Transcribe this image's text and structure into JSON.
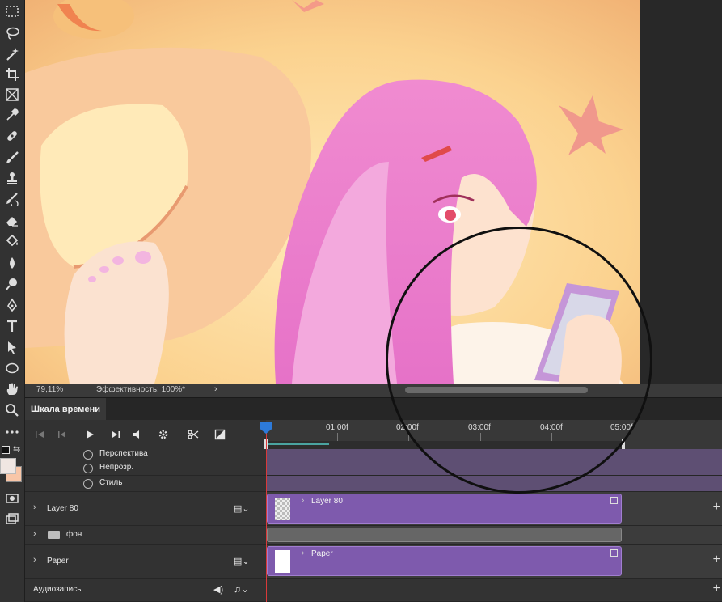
{
  "status_bar": {
    "zoom": "79,11%",
    "efficiency": "Эффективность: 100%*",
    "menu_arrow": "›"
  },
  "timeline": {
    "tab_title": "Шкала времени",
    "ruler": [
      "01:00f",
      "02:00f",
      "03:00f",
      "04:00f",
      "05:00f"
    ],
    "properties": [
      {
        "label": "Перспектива"
      },
      {
        "label": "Непрозр."
      },
      {
        "label": "Стиль"
      }
    ],
    "layers": [
      {
        "name": "Layer 80",
        "clip_title": "Layer 80"
      },
      {
        "name": "фон"
      },
      {
        "name": "Paper",
        "clip_title": "Paper"
      }
    ],
    "audio_label": "Аудиозапись",
    "plus": "+"
  },
  "colors": {
    "clip": "#7e5aad",
    "playhead": "#d93a3a",
    "foreground_swatch": "#f0e6e2",
    "background_swatch": "#f8c6a8"
  },
  "icons": {
    "toolbar": [
      "marquee-icon",
      "lasso-icon",
      "magic-wand-icon",
      "crop-icon",
      "frame-icon",
      "eyedropper-icon",
      "healing-brush-icon",
      "brush-icon",
      "stamp-icon",
      "history-brush-icon",
      "eraser-icon",
      "paint-bucket-icon",
      "blur-icon",
      "dodge-icon",
      "pen-icon",
      "type-icon",
      "path-selection-icon",
      "ellipse-icon",
      "hand-icon",
      "zoom-icon",
      "more-tools-icon"
    ],
    "timeline_controls": [
      "first-frame-icon",
      "prev-frame-icon",
      "play-icon",
      "next-frame-icon",
      "audio-icon",
      "settings-icon",
      "split-icon",
      "transition-icon"
    ]
  }
}
